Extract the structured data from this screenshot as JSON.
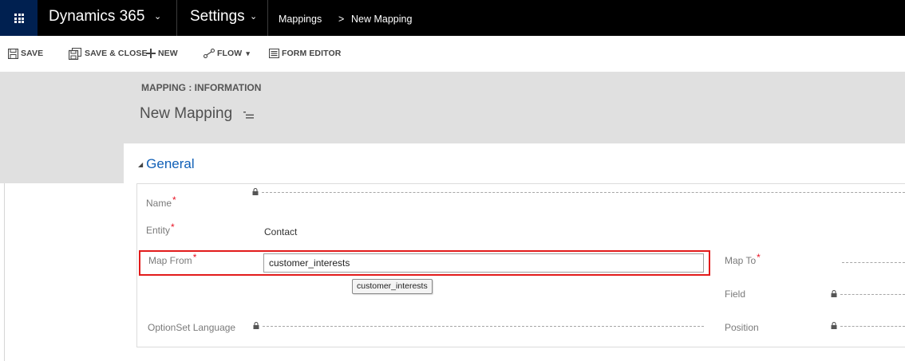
{
  "topnav": {
    "app_name": "Dynamics 365",
    "area_name": "Settings",
    "breadcrumb": [
      "Mappings",
      "New Mapping"
    ],
    "breadcrumb_separator": ">",
    "chevron": "⌄"
  },
  "commands": {
    "save": "SAVE",
    "save_close": "SAVE & CLOSE",
    "new": "NEW",
    "flow": "FLOW",
    "flow_caret": "▾",
    "form_editor": "FORM EDITOR"
  },
  "header": {
    "form_label": "MAPPING : INFORMATION",
    "record_title": "New Mapping"
  },
  "section": {
    "title": "General",
    "collapse_glyph": "◢"
  },
  "fields": {
    "name_label": "Name",
    "entity_label": "Entity",
    "entity_value": "Contact",
    "map_from_label": "Map From",
    "map_from_value": "customer_interests",
    "autocomplete_suggestion": "customer_interests",
    "optionset_label": "OptionSet Language",
    "map_to_label": "Map To",
    "field_label": "Field",
    "position_label": "Position",
    "required_marker": "*"
  },
  "colors": {
    "nav_bg": "#000000",
    "waffle_bg": "#002050",
    "header_band": "#e0e0e0",
    "section_title": "#1160b7",
    "required": "#e81123",
    "highlight_border": "#e21b1b"
  }
}
